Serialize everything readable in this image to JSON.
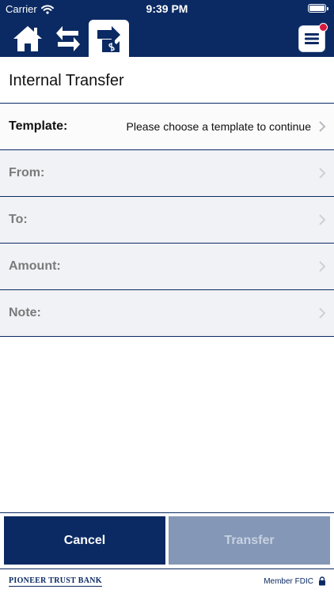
{
  "status_bar": {
    "carrier": "Carrier",
    "time": "9:39 PM"
  },
  "nav": {
    "home_icon": "home-icon",
    "transfers_icon": "transfer-arrows-icon",
    "payments_icon": "bill-pay-icon",
    "menu_icon": "hamburger-menu-icon",
    "notification": "red-dot"
  },
  "page": {
    "title": "Internal Transfer"
  },
  "form": {
    "rows": [
      {
        "label": "Template:",
        "value": "Please choose a template to continue"
      },
      {
        "label": "From:",
        "value": ""
      },
      {
        "label": "To:",
        "value": ""
      },
      {
        "label": "Amount:",
        "value": ""
      },
      {
        "label": "Note:",
        "value": ""
      }
    ]
  },
  "actions": {
    "cancel_label": "Cancel",
    "transfer_label": "Transfer"
  },
  "footer": {
    "bank_name": "PIONEER TRUST BANK",
    "fdic": "Member FDIC"
  },
  "colors": {
    "brand": "#0b2a63",
    "disabled": "#8497b6",
    "notification": "#d7193e"
  }
}
